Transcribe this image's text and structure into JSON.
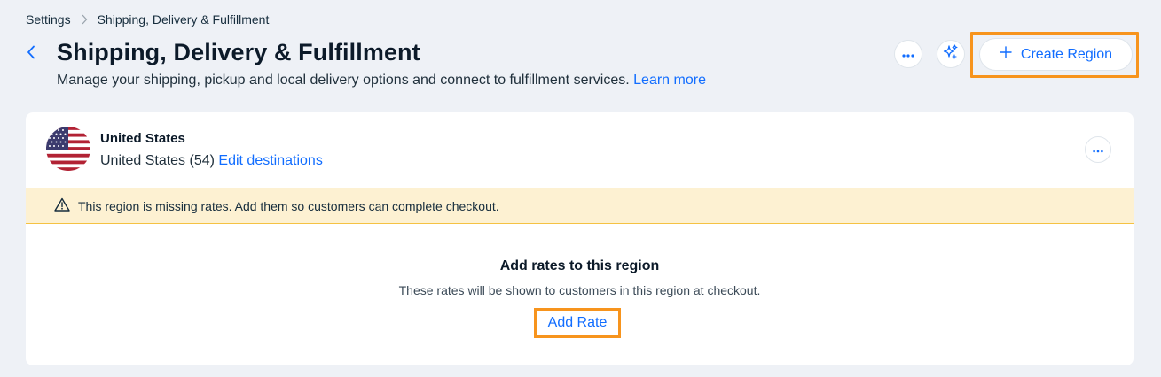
{
  "breadcrumb": {
    "parent": "Settings",
    "current": "Shipping, Delivery & Fulfillment"
  },
  "header": {
    "title": "Shipping, Delivery & Fulfillment",
    "subtitle": "Manage your shipping, pickup and local delivery options and connect to fulfillment services.",
    "learn_more": "Learn more",
    "create_region_label": "Create Region"
  },
  "region": {
    "name": "United States",
    "destinations": "United States (54)",
    "edit_destinations": "Edit destinations",
    "warning": "This region is missing rates. Add them so customers can complete checkout.",
    "empty_title": "Add rates to this region",
    "empty_description": "These rates will be shown to customers in this region at checkout.",
    "add_rate_label": "Add Rate"
  },
  "icons": {
    "back": "chevron-left-icon",
    "breadcrumb_separator": "chevron-right-icon",
    "more": "more-horizontal-icon",
    "ai": "sparkle-icon",
    "plus": "plus-icon",
    "flag": "us-flag-icon",
    "warning": "warning-triangle-icon"
  },
  "colors": {
    "accent": "#116dff",
    "background": "#eef1f6",
    "warning_bg": "#fdf1d2",
    "warning_border": "#f5c242",
    "highlight": "#f7941d"
  }
}
